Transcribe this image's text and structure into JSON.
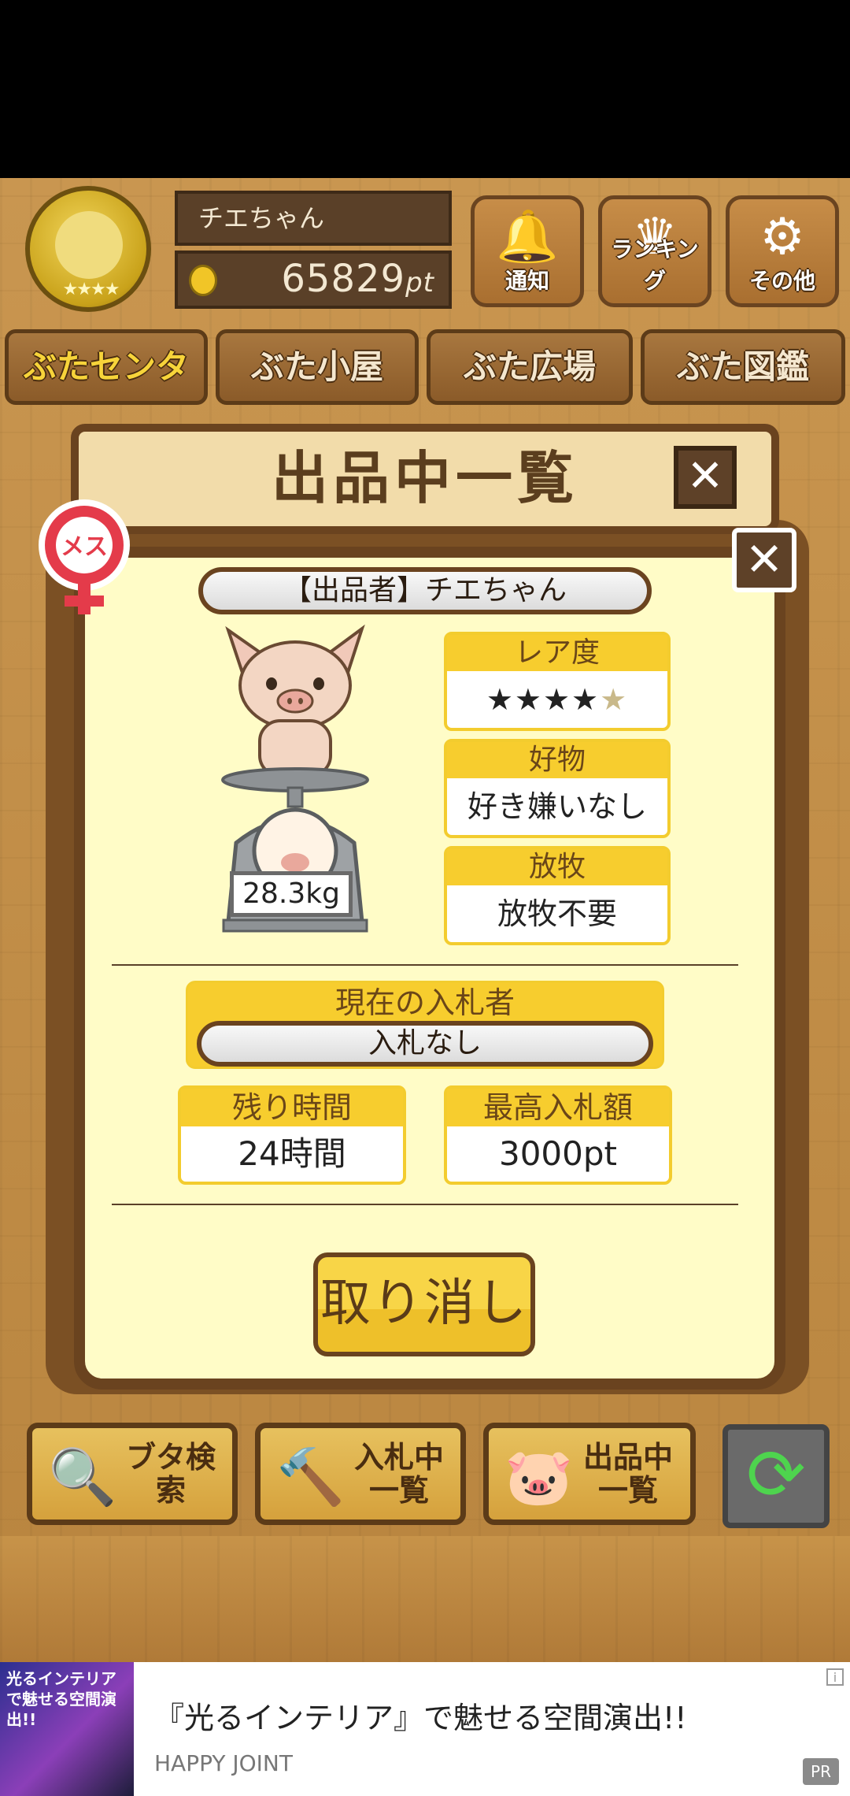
{
  "header": {
    "player_name": "チエちゃん",
    "points": "65829",
    "points_unit": "pt",
    "buttons": {
      "notify": "通知",
      "ranking": "ランキング",
      "other": "その他"
    }
  },
  "nav_tabs": [
    "ぶたセンター",
    "ぶた小屋",
    "ぶた広場",
    "ぶた図鑑"
  ],
  "dialog": {
    "title": "出品中一覧",
    "gender_label": "メス",
    "seller": "【出品者】チエちゃん",
    "weight": "28.3kg",
    "rarity": {
      "label": "レア度",
      "value": 4,
      "max": 5
    },
    "favorite": {
      "label": "好物",
      "value": "好き嫌いなし"
    },
    "grazing": {
      "label": "放牧",
      "value": "放牧不要"
    },
    "current_bidder": {
      "label": "現在の入札者",
      "value": "入札なし"
    },
    "time_left": {
      "label": "残り時間",
      "value": "24時間"
    },
    "highest_bid": {
      "label": "最高入札額",
      "value": "3000pt"
    },
    "cancel_label": "取り消し",
    "close_symbol": "✕"
  },
  "bottom_nav": {
    "search": "ブタ検索",
    "bidding_line1": "入札中",
    "bidding_line2": "一覧",
    "listing_line1": "出品中",
    "listing_line2": "一覧"
  },
  "ad": {
    "thumb_text": "光るインテリアで魅せる空間演出!!",
    "title": "『光るインテリア』で魅せる空間演出!!",
    "advertiser": "HAPPY JOINT",
    "pr": "PR",
    "info": "i"
  },
  "colors": {
    "wood": "#c18c47",
    "dialog_bg": "#fffcc7",
    "accent_yellow": "#f7cd2e",
    "frame_brown": "#6a431f",
    "star_red": "#e05050"
  },
  "icons": {
    "notify": "bell-icon",
    "ranking": "crown-icon",
    "other": "gear-icon",
    "search": "magnifier-icon",
    "bidding": "gavel-icon",
    "listing": "pig-icon",
    "refresh": "refresh-icon"
  }
}
